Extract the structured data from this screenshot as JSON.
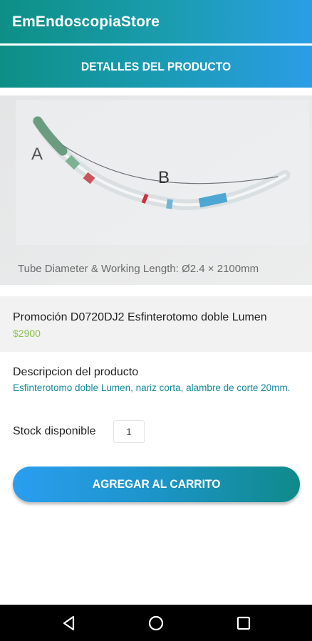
{
  "app": {
    "title": "EmEndoscopiaStore"
  },
  "header": {
    "title": "DETALLES DEL PRODUCTO"
  },
  "product": {
    "image_caption": "Tube Diameter & Working Length: Ø2.4 × 2100mm",
    "image_label_a": "A",
    "image_label_b": "B",
    "name": "Promoción D0720DJ2 Esfinterotomo doble Lumen",
    "price": "$2900",
    "description_label": "Descripcion del producto",
    "description": "Esfinterotomo doble Lumen, nariz corta, alambre de corte 20mm.",
    "stock_label": "Stock disponible",
    "stock_value": "1"
  },
  "actions": {
    "add_to_cart": "AGREGAR AL CARRITO"
  },
  "navbar": {
    "back_icon": "back-triangle",
    "home_icon": "home-circle",
    "recents_icon": "recents-square"
  },
  "colors": {
    "teal": "#0d8f86",
    "blue": "#2a9ee6",
    "price": "#8bc34a",
    "description": "#138a9b"
  }
}
